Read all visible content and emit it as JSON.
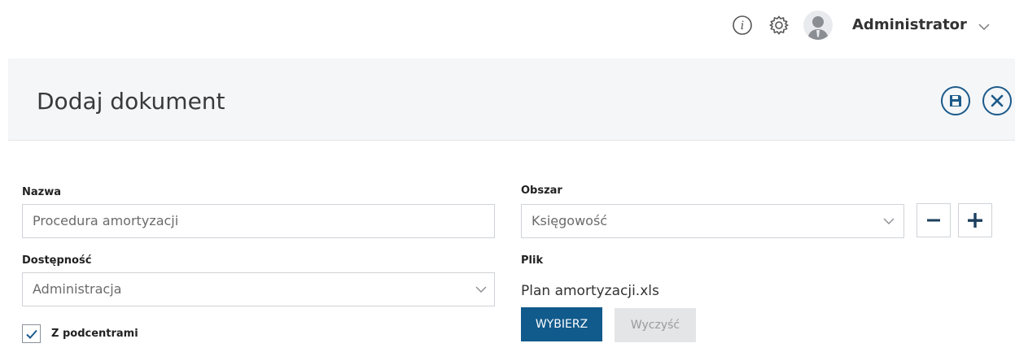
{
  "topbar": {
    "user_name": "Administrator"
  },
  "header": {
    "title": "Dodaj dokument"
  },
  "form": {
    "nazwa": {
      "label": "Nazwa",
      "value": "Procedura amortyzacji"
    },
    "obszar": {
      "label": "Obszar",
      "value": "Księgowość"
    },
    "dostepnosc": {
      "label": "Dostępność",
      "value": "Administracja"
    },
    "plik": {
      "label": "Plik",
      "file_name": "Plan amortyzacji.xls",
      "choose_label": "WYBIERZ",
      "clear_label": "Wyczyść"
    },
    "subcenters": {
      "label": "Z podcentrami",
      "checked": true
    }
  },
  "colors": {
    "accent": "#115a8c",
    "header_bg": "#f4f6f8",
    "icon_dark": "#1c5a8a"
  },
  "icons": {
    "info": "info-icon",
    "settings": "gear-icon",
    "user": "avatar",
    "save": "save-icon",
    "close": "close-icon",
    "remove": "minus-icon",
    "add": "plus-icon"
  }
}
